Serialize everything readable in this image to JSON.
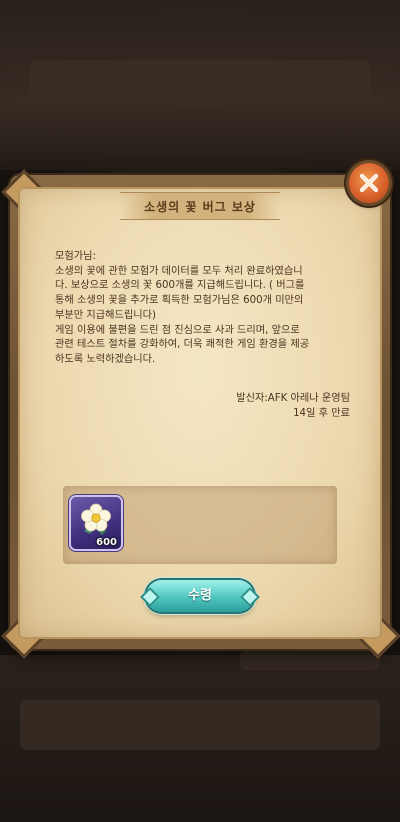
{
  "dialog": {
    "title": "소생의 꽃 버그 보상",
    "greeting": "모험가님:",
    "body_lines": [
      "소생의 꽃에 관한 모험가 데이터를 모두 처리 완료하였습니",
      "다. 보상으로 소생의 꽃 600개를 지급해드립니다. ( 버그를",
      "통해 소생의 꽃을 추가로 획득한 모험가님은 600개 미만의",
      "부분만 지급해드립니다)",
      "게임 이용에 불편을 드린 점 진심으로 사과 드리며, 앞으로",
      "관련 테스트 절차를 강화하여, 더욱 쾌적한 게임 환경을 제공",
      "하도록 노력하겠습니다."
    ],
    "sender": "발신자:AFK 아레나 운영팀",
    "expiry": "14일 후 만료",
    "close_icon": "close-icon"
  },
  "reward": {
    "item_name_icon": "revival-flower-icon",
    "count": "600"
  },
  "claim_button": {
    "label": "수령"
  },
  "colors": {
    "accent_orange": "#d9622b",
    "parchment": "#f0dfba",
    "button_teal": "#4fc6c0",
    "item_purple": "#3f2f7e"
  }
}
